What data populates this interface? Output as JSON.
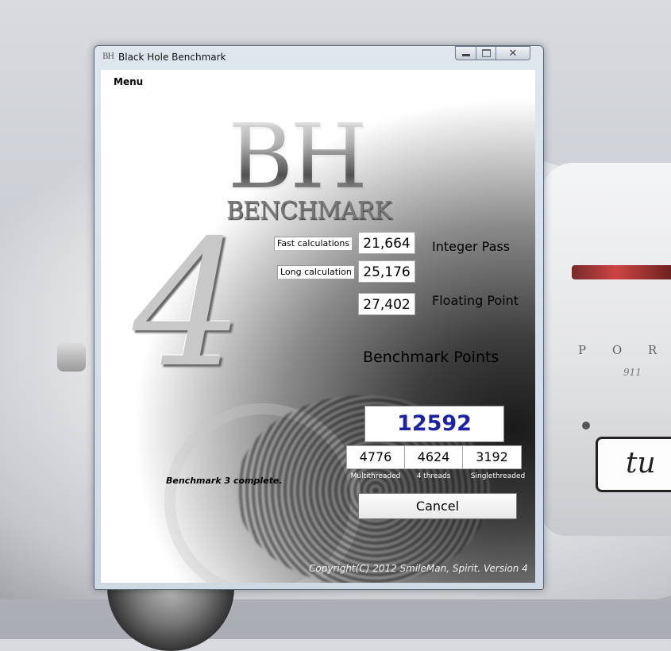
{
  "window": {
    "title": "Black Hole Benchmark",
    "app_icon_text": "BH",
    "close_glyph": "✕"
  },
  "menu": {
    "label": "Menu"
  },
  "logo": {
    "main": "BH",
    "sub": "BENCHMARK",
    "version_glyph": "4"
  },
  "integer": {
    "fast_label": "Fast calculations",
    "fast_value": "21,664",
    "long_label": "Long calculation",
    "long_value": "25,176",
    "section_label": "Integer Pass"
  },
  "floating": {
    "value": "27,402",
    "section_label": "Floating Point"
  },
  "benchmark": {
    "title": "Benchmark Points",
    "total": "12592",
    "multithreaded": "4776",
    "four_threads": "4624",
    "singlethreaded": "3192",
    "multithreaded_label": "Multithreaded",
    "four_threads_label": "4 threads",
    "singlethreaded_label": "Singlethreaded"
  },
  "status": {
    "text": "Benchmark 3 complete."
  },
  "actions": {
    "cancel_label": "Cancel"
  },
  "footer": {
    "copyright": "Copyright(C) 2012 SmileMan, Spirit. Version 4"
  },
  "desktop": {
    "car_badge": "P O R",
    "car_model": "911",
    "plate_text": "tu"
  },
  "colors": {
    "score_text": "#1a23a8"
  }
}
